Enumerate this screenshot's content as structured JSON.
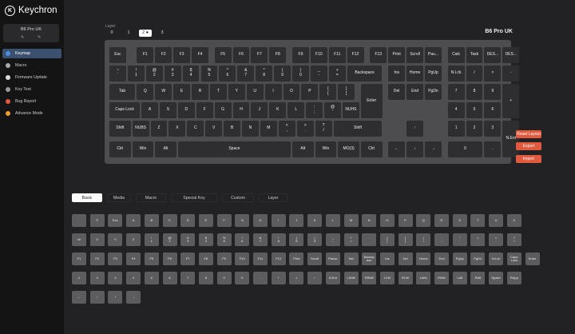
{
  "app": {
    "brand": "Keychron"
  },
  "device_card": {
    "name": "B6 Pro UK"
  },
  "sidebar": {
    "items": [
      {
        "label": "Keymap",
        "icon": "keyboard-icon",
        "color": "#4a90e2",
        "active": true
      },
      {
        "label": "Macro",
        "icon": "macro-icon",
        "color": "#aaaaaa",
        "active": false
      },
      {
        "label": "Firmware Update",
        "icon": "update-icon",
        "color": "#dddddd",
        "active": false
      },
      {
        "label": "Key Test",
        "icon": "keytest-icon",
        "color": "#999999",
        "active": false
      },
      {
        "label": "Bug Report",
        "icon": "bug-icon",
        "color": "#e25a3e",
        "active": false
      },
      {
        "label": "Advance Mode",
        "icon": "advance-icon",
        "color": "#f0a030",
        "active": false
      }
    ]
  },
  "layer": {
    "label": "Layer",
    "options": [
      "0",
      "1",
      "2",
      "3"
    ],
    "selected": 2
  },
  "device_title": "B6 Pro UK",
  "keyboard": {
    "rows": [
      [
        [
          "Esc"
        ],
        [
          "F1"
        ],
        [
          "F2"
        ],
        [
          "F3"
        ],
        [
          "F4"
        ],
        [
          "F5"
        ],
        [
          "F6"
        ],
        [
          "F7"
        ],
        [
          "F8"
        ],
        [
          "F9"
        ],
        [
          "F10"
        ],
        [
          "F11"
        ],
        [
          "F12"
        ],
        [
          "F13"
        ],
        [
          "Print"
        ],
        [
          "Scroll"
        ],
        [
          "Pau..."
        ],
        [
          "Calc"
        ],
        [
          "Task"
        ],
        [
          "DES..."
        ],
        [
          "DES..."
        ]
      ],
      [
        [
          "~",
          "`"
        ],
        [
          "!",
          "1"
        ],
        [
          "@",
          "2"
        ],
        [
          "#",
          "3"
        ],
        [
          "$",
          "4"
        ],
        [
          "%",
          "5"
        ],
        [
          "^",
          "6"
        ],
        [
          "&",
          "7"
        ],
        [
          "*",
          "8"
        ],
        [
          "(",
          "9"
        ],
        [
          ")",
          "0"
        ],
        [
          "_",
          "-"
        ],
        [
          "+",
          "="
        ],
        [
          "Backspace"
        ],
        [
          "Ins"
        ],
        [
          "Home"
        ],
        [
          "PgUp"
        ],
        [
          "N.Lck"
        ],
        [
          "/"
        ],
        [
          "×"
        ],
        [
          "-"
        ]
      ],
      [
        [
          "Tab"
        ],
        [
          "Q"
        ],
        [
          "W"
        ],
        [
          "E"
        ],
        [
          "R"
        ],
        [
          "T"
        ],
        [
          "Y"
        ],
        [
          "U"
        ],
        [
          "I"
        ],
        [
          "O"
        ],
        [
          "P"
        ],
        [
          "{",
          "["
        ],
        [
          "}",
          "]"
        ],
        [
          "Enter"
        ],
        [
          "Del"
        ],
        [
          "End"
        ],
        [
          "PgDn"
        ],
        [
          "7"
        ],
        [
          "8"
        ],
        [
          "9"
        ],
        [
          "+"
        ]
      ],
      [
        [
          "Caps Lock"
        ],
        [
          "A"
        ],
        [
          "S"
        ],
        [
          "D"
        ],
        [
          "F"
        ],
        [
          "G"
        ],
        [
          "H"
        ],
        [
          "J"
        ],
        [
          "K"
        ],
        [
          "L"
        ],
        [
          ":",
          ";"
        ],
        [
          "@",
          "'"
        ],
        [
          "NUHS"
        ],
        [
          "4"
        ],
        [
          "5"
        ],
        [
          "6"
        ]
      ],
      [
        [
          "Shift"
        ],
        [
          "NUBS"
        ],
        [
          "Z"
        ],
        [
          "X"
        ],
        [
          "C"
        ],
        [
          "V"
        ],
        [
          "B"
        ],
        [
          "N"
        ],
        [
          "M"
        ],
        [
          "<",
          ","
        ],
        [
          ">",
          "."
        ],
        [
          "?",
          "/"
        ],
        [
          "Shift"
        ],
        [
          "↑"
        ],
        [
          "1"
        ],
        [
          "2"
        ],
        [
          "3"
        ],
        [
          "N.Ent"
        ]
      ],
      [
        [
          "Ctrl"
        ],
        [
          "Win"
        ],
        [
          "Alt"
        ],
        [
          "Space"
        ],
        [
          "Alt"
        ],
        [
          "Win"
        ],
        [
          "MO(3)"
        ],
        [
          "Ctrl"
        ],
        [
          "←"
        ],
        [
          "↓"
        ],
        [
          "→"
        ],
        [
          "0"
        ],
        [
          "."
        ]
      ]
    ]
  },
  "actions": {
    "reset": "Reset Layout",
    "export": "Export",
    "import": "Import"
  },
  "tabs": [
    {
      "label": "Basic",
      "active": true
    },
    {
      "label": "Media",
      "active": false
    },
    {
      "label": "Macro",
      "active": false
    },
    {
      "label": "Special Key",
      "active": false
    },
    {
      "label": "Custom",
      "active": false
    },
    {
      "label": "Layer",
      "active": false
    }
  ],
  "palette": {
    "rows": [
      [
        [
          ""
        ],
        [
          "▽"
        ],
        [
          "Esc"
        ],
        [
          "A"
        ],
        [
          "B"
        ],
        [
          "C"
        ],
        [
          "D"
        ],
        [
          "E"
        ],
        [
          "F"
        ],
        [
          "G"
        ],
        [
          "H"
        ],
        [
          "I"
        ],
        [
          "J"
        ],
        [
          "K"
        ],
        [
          "L"
        ],
        [
          "M"
        ],
        [
          "N"
        ],
        [
          "O"
        ],
        [
          "P"
        ],
        [
          "Q"
        ],
        [
          "R"
        ],
        [
          "S"
        ],
        [
          "T"
        ],
        [
          "U"
        ],
        [
          "V"
        ]
      ],
      [
        [
          "W"
        ],
        [
          "X"
        ],
        [
          "Y"
        ],
        [
          "Z"
        ],
        [
          "!",
          "1"
        ],
        [
          "@",
          "2"
        ],
        [
          "#",
          "3"
        ],
        [
          "$",
          "4"
        ],
        [
          "%",
          "5"
        ],
        [
          "^",
          "6"
        ],
        [
          "&",
          "7"
        ],
        [
          "*",
          "8"
        ],
        [
          "(",
          "9"
        ],
        [
          ")",
          "0"
        ],
        [
          "_",
          "-"
        ],
        [
          "+",
          "="
        ],
        [
          "`"
        ],
        [
          "{",
          "["
        ],
        [
          "}",
          "]"
        ],
        [
          "|",
          "\\"
        ],
        [
          ":",
          ";"
        ],
        [
          "\"",
          "'"
        ],
        [
          "<",
          ","
        ],
        [
          ">",
          "."
        ],
        [
          "?",
          "/"
        ]
      ],
      [
        [
          "F1"
        ],
        [
          "F2"
        ],
        [
          "F3"
        ],
        [
          "F4"
        ],
        [
          "F5"
        ],
        [
          "F6"
        ],
        [
          "F7"
        ],
        [
          "F8"
        ],
        [
          "F9"
        ],
        [
          "F10"
        ],
        [
          "F11"
        ],
        [
          "F12"
        ],
        [
          "Print"
        ],
        [
          "Scroll"
        ],
        [
          "Pause"
        ],
        [
          "Tab"
        ],
        [
          "Backsp",
          "ace"
        ],
        [
          "Ins"
        ],
        [
          "Del"
        ],
        [
          "Home"
        ],
        [
          "End"
        ],
        [
          "PgUp"
        ],
        [
          "PgDn"
        ],
        [
          "N.Lck"
        ],
        [
          "Caps",
          "Lock"
        ],
        [
          "Enter"
        ]
      ],
      [
        [
          "1"
        ],
        [
          "2"
        ],
        [
          "3"
        ],
        [
          "4"
        ],
        [
          "5"
        ],
        [
          "6"
        ],
        [
          "7"
        ],
        [
          "8"
        ],
        [
          "9"
        ],
        [
          "0"
        ],
        [
          "-"
        ],
        [
          "+"
        ],
        [
          "×"
        ],
        [
          "/"
        ],
        [
          "N.Ent"
        ],
        [
          "LShift"
        ],
        [
          "RShift"
        ],
        [
          "LCtrl"
        ],
        [
          "RCtrl"
        ],
        [
          "LWin"
        ],
        [
          "RWin"
        ],
        [
          "LAlt"
        ],
        [
          "RAlt"
        ],
        [
          "Space"
        ],
        [
          "RApp"
        ]
      ],
      [
        [
          "←"
        ],
        [
          "↓"
        ],
        [
          "↑"
        ],
        [
          "→"
        ]
      ]
    ]
  }
}
